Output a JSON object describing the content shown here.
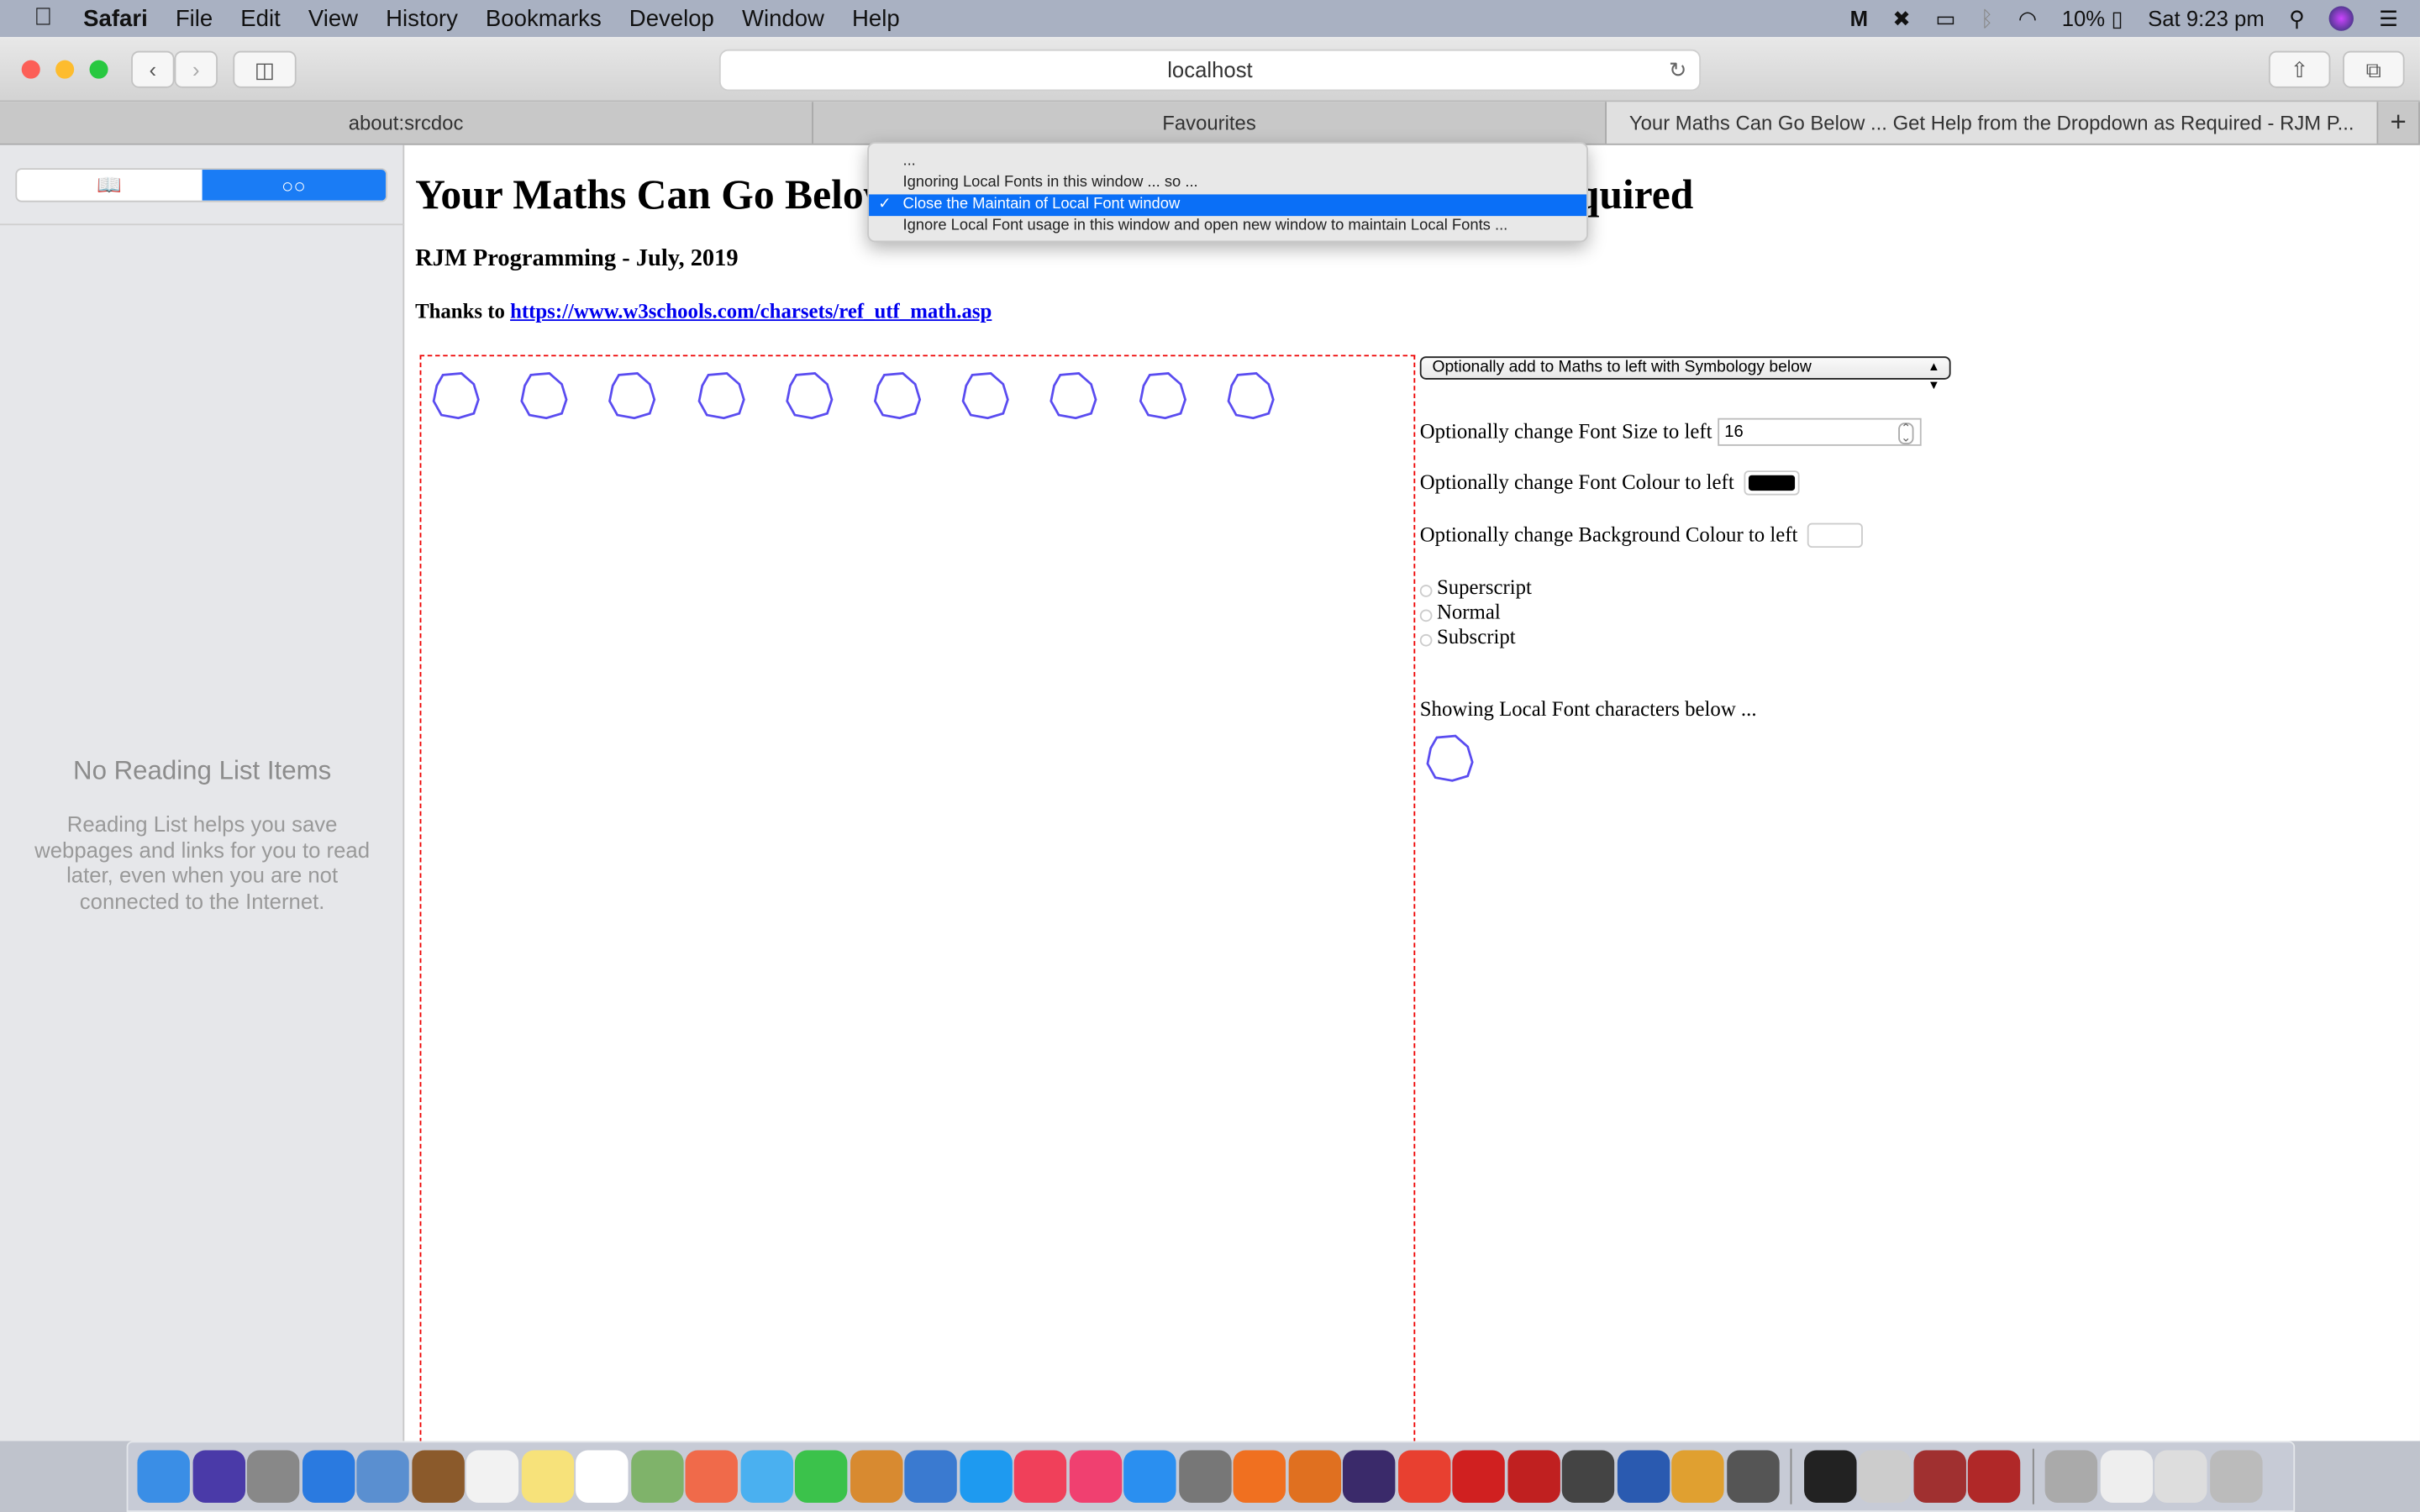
{
  "menubar": {
    "app": "Safari",
    "items": [
      "File",
      "Edit",
      "View",
      "History",
      "Bookmarks",
      "Develop",
      "Window",
      "Help"
    ],
    "battery": "10%",
    "clock": "Sat 9:23 pm"
  },
  "toolbar": {
    "url": "localhost"
  },
  "tabs": [
    {
      "label": "about:srcdoc",
      "active": false
    },
    {
      "label": "Favourites",
      "active": false
    },
    {
      "label": "Your Maths Can Go Below ... Get Help from the Dropdown as Required - RJM P...",
      "active": true
    }
  ],
  "sidebar": {
    "empty_title": "No Reading List Items",
    "empty_desc": "Reading List helps you save webpages and links for you to read later, even when you are not connected to the Internet."
  },
  "page": {
    "title": "Your Maths Can Go Below ... Get Help from the Dropdown as Required",
    "subtitle": "RJM Programming - July, 2019",
    "thanks_prefix": "Thanks to ",
    "thanks_link": "https://www.w3schools.com/charsets/ref_utf_math.asp",
    "math_glyph_count": 10,
    "glyph_color": "#5a4cf0",
    "symbology_select": "Optionally add to Maths to left with Symbology below",
    "font_size_label": "Optionally change Font Size to left",
    "font_size_value": "16",
    "font_colour_label": "Optionally change Font Colour to left",
    "font_colour": "#000000",
    "bg_colour_label": "Optionally change Background Colour to left",
    "bg_colour": "#ffffff",
    "radios": [
      "Superscript",
      "Normal",
      "Subscript"
    ],
    "showing_label": "Showing Local Font characters below ..."
  },
  "popup": {
    "options": [
      "...",
      "Ignoring Local Fonts in this window ... so ...",
      "Close the Maintain of Local Font window",
      "Ignore Local Font usage in this window and open new window to maintain Local Fonts ..."
    ],
    "selected_index": 2
  }
}
